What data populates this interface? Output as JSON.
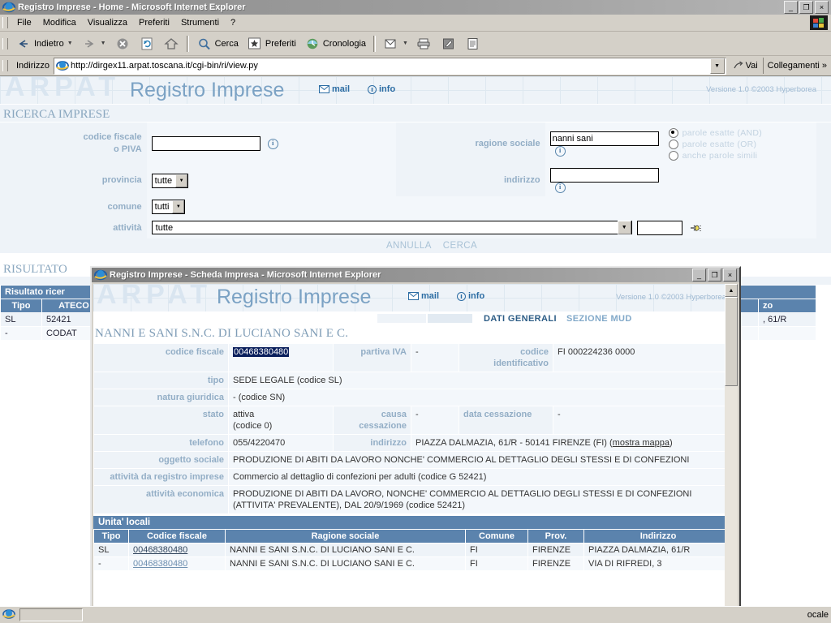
{
  "browser": {
    "title": "Registro Imprese - Home - Microsoft Internet Explorer",
    "menu": [
      "File",
      "Modifica",
      "Visualizza",
      "Preferiti",
      "Strumenti",
      "?"
    ],
    "toolbar": {
      "back": "Indietro",
      "search": "Cerca",
      "favorites": "Preferiti",
      "history": "Cronologia"
    },
    "address": {
      "label": "Indirizzo",
      "url": "http://dirgex11.arpat.toscana.it/cgi-bin/ri/view.py",
      "go": "Vai",
      "links": "Collegamenti"
    },
    "window_buttons": {
      "minimize": "_",
      "restore": "❐",
      "close": "×"
    },
    "status": {
      "zone": "ocale"
    }
  },
  "page": {
    "banner": {
      "watermark": "ARPAT",
      "title": "Registro Imprese",
      "mail": "mail",
      "info": "info",
      "version": "Versione 1.0  ©2003 Hyperborea"
    },
    "section_title": "RICERCA IMPRESE",
    "form": {
      "codice_fiscale_label": "codice fiscale\no PIVA",
      "codice_fiscale_value": "",
      "ragione_sociale_label": "ragione sociale",
      "ragione_sociale_value": "nanni sani",
      "provincia_label": "provincia",
      "provincia_value": "tutte",
      "indirizzo_label": "indirizzo",
      "indirizzo_value": "",
      "comune_label": "comune",
      "comune_value": "tutti",
      "attivita_label": "attività",
      "attivita_value": "tutte",
      "attivita_code_value": "",
      "match_options": [
        {
          "label": "parole esatte (AND)",
          "selected": true
        },
        {
          "label": "parole esatte (OR)",
          "selected": false
        },
        {
          "label": "anche parole simili",
          "selected": false
        }
      ],
      "cancel": "ANNULLA",
      "search": "CERCA"
    },
    "results": {
      "section_title": "RISULTATO",
      "caption": "Risultato ricer",
      "headers": [
        "Tipo",
        "ATECO",
        "zo"
      ],
      "rows": [
        {
          "tipo": "SL",
          "ateco": "52421",
          "ind": ", 61/R"
        },
        {
          "tipo": "-",
          "ateco": "CODAT",
          "ind": ""
        }
      ]
    }
  },
  "child_window": {
    "title": "Registro Imprese - Scheda Impresa - Microsoft Internet Explorer",
    "banner": {
      "watermark": "ARPAT",
      "title": "Registro Imprese",
      "mail": "mail",
      "info": "info",
      "version": "Versione 1.0  ©2003 Hyperborea"
    },
    "tabs": [
      {
        "label": "DATI GENERALI",
        "active": true
      },
      {
        "label": "SEZIONE MUD",
        "active": false
      }
    ],
    "company_name": "NANNI E SANI S.N.C. DI LUCIANO SANI E C.",
    "details": [
      {
        "label1": "codice fiscale",
        "value1": "00468380480",
        "value1_highlighted": true,
        "label2": "partiva IVA",
        "value2": "-",
        "label3": "codice identificativo",
        "value3": "FI 000224236 0000"
      },
      {
        "label1": "tipo",
        "value1": "SEDE LEGALE (codice SL)"
      },
      {
        "label1": "natura giuridica",
        "value1": "- (codice SN)"
      },
      {
        "label1": "stato",
        "value1": "attiva\n(codice 0)",
        "label2": "causa cessazione",
        "value2": "-",
        "label3": "data cessazione",
        "value3": "-"
      },
      {
        "label1": "telefono",
        "value1": "055/4220470",
        "label2": "indirizzo",
        "value2": "PIAZZA DALMAZIA, 61/R - 50141 FIRENZE (FI) (",
        "value2_link": "mostra mappa",
        "value2_tail": ")"
      },
      {
        "label1": "oggetto sociale",
        "value1": "PRODUZIONE DI ABITI DA LAVORO NONCHE' COMMERCIO AL DETTAGLIO DEGLI STESSI E DI CONFEZIONI"
      },
      {
        "label1": "attività da registro imprese",
        "value1": "Commercio al dettaglio di confezioni per adulti (codice G 52421)"
      },
      {
        "label1": "attività economica",
        "value1": "PRODUZIONE DI ABITI DA LAVORO, NONCHE' COMMERCIO AL DETTAGLIO DEGLI STESSI E DI CONFEZIONI (ATTIVITA' PREVALENTE), DAL 20/9/1969 (codice 52421)"
      }
    ],
    "unita_locali": {
      "caption": "Unita' locali",
      "headers": [
        "Tipo",
        "Codice fiscale",
        "Ragione sociale",
        "Comune",
        "Prov.",
        "Indirizzo"
      ],
      "rows": [
        {
          "tipo": "SL",
          "codice_fiscale": "00468380480",
          "ragione_sociale": "NANNI E SANI S.N.C. DI LUCIANO SANI E C.",
          "comune": "FI",
          "prov": "FIRENZE",
          "indirizzo": "PIAZZA DALMAZIA, 61/R"
        },
        {
          "tipo": "-",
          "codice_fiscale": "00468380480",
          "ragione_sociale": "NANNI E SANI S.N.C. DI LUCIANO SANI E C.",
          "comune": "FI",
          "prov": "FIRENZE",
          "indirizzo": "VIA DI RIFREDI, 3"
        }
      ]
    },
    "window_buttons": {
      "minimize": "_",
      "maximize": "❐",
      "close": "×"
    }
  },
  "colors": {
    "accent_blue": "#5b83ad",
    "label_blue": "#93aec6",
    "panel_bg": "#eef3f8",
    "chrome": "#d4d0c8",
    "highlight": "#0a1f5c"
  }
}
